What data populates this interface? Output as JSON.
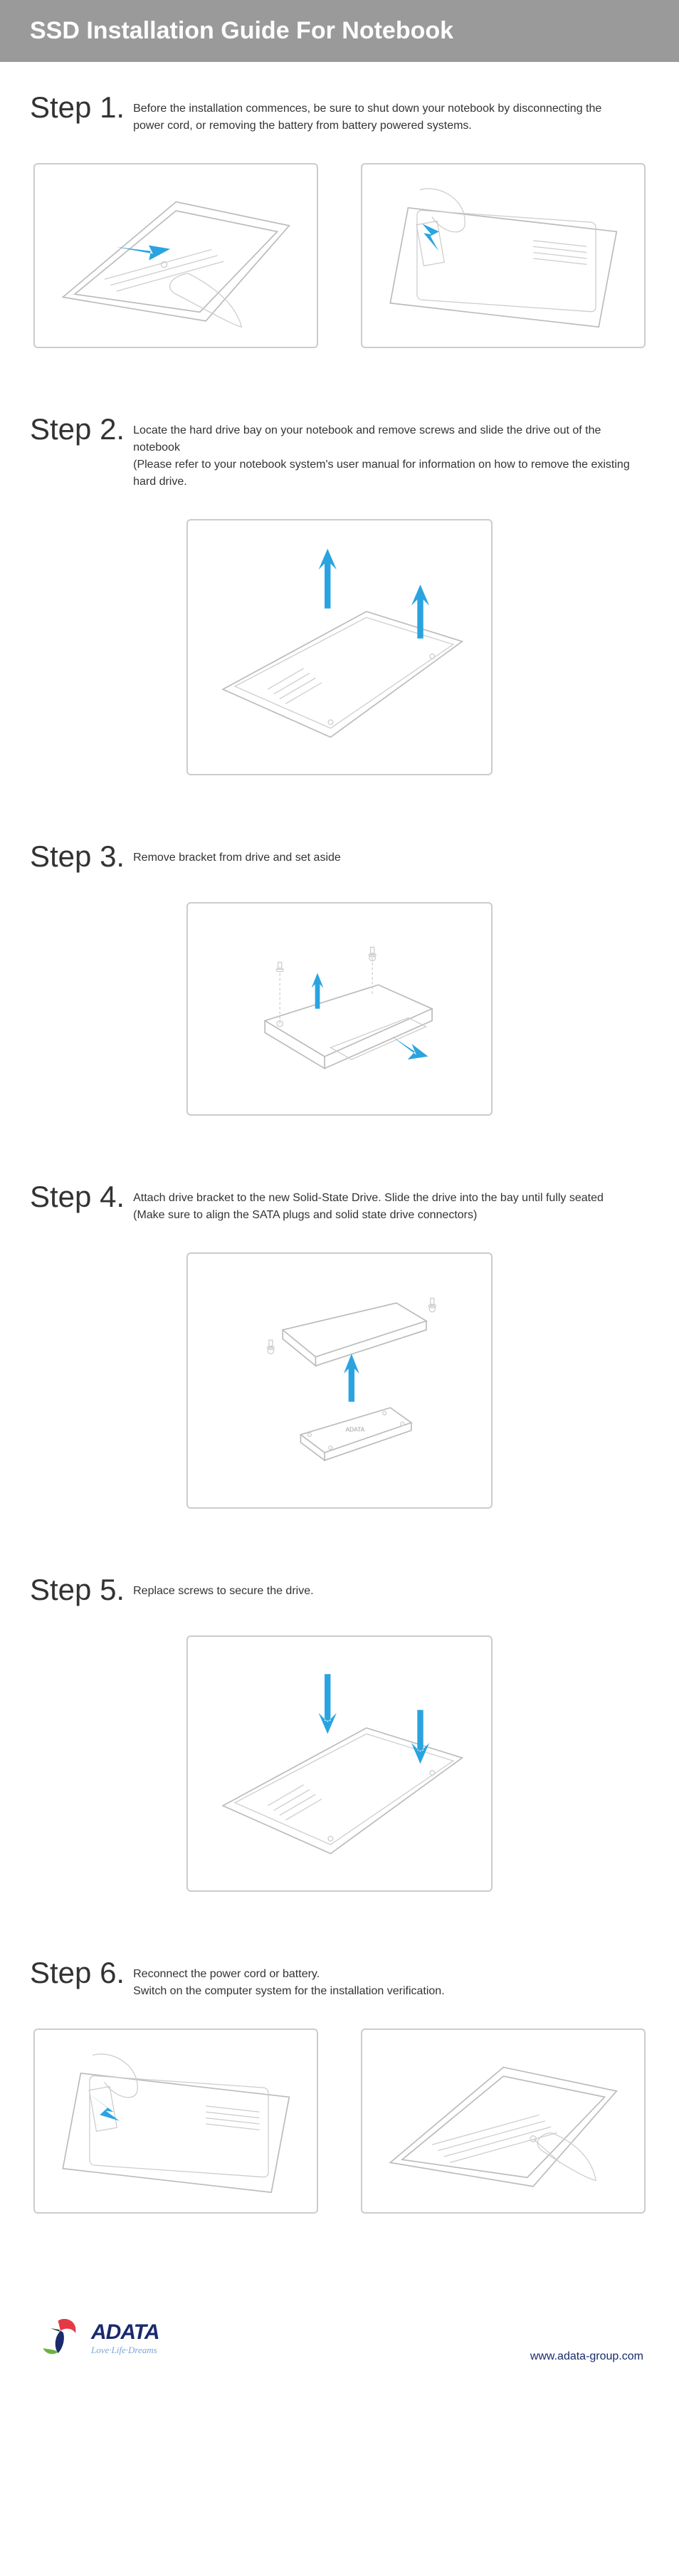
{
  "header": {
    "title": "SSD Installation Guide For Notebook"
  },
  "steps": [
    {
      "label": "Step 1.",
      "text": "Before the installation commences, be sure to shut down your notebook by disconnecting the power cord, or removing the battery from battery powered systems."
    },
    {
      "label": "Step 2.",
      "text": "Locate the hard drive bay on your notebook and remove screws and slide the drive out of the notebook\n(Please refer to your notebook system's user manual for information on how to remove the existing hard drive."
    },
    {
      "label": "Step 3.",
      "text": "Remove bracket from drive and set aside"
    },
    {
      "label": "Step 4.",
      "text": "Attach drive bracket to the new Solid-State Drive. Slide the drive into the bay until fully seated (Make sure to align the SATA plugs and solid state drive connectors)"
    },
    {
      "label": "Step 5.",
      "text": "Replace screws to secure the drive."
    },
    {
      "label": "Step 6.",
      "text": "Reconnect the power cord or battery.\nSwitch on the computer system for the installation verification."
    }
  ],
  "footer": {
    "brand": "ADATA",
    "tagline": "Love·Life·Dreams",
    "url": "www.adata-group.com"
  },
  "colors": {
    "accent": "#2aa4e0",
    "logo_blue": "#1a2a6c",
    "logo_red": "#e63946",
    "logo_green": "#6bb33f"
  }
}
